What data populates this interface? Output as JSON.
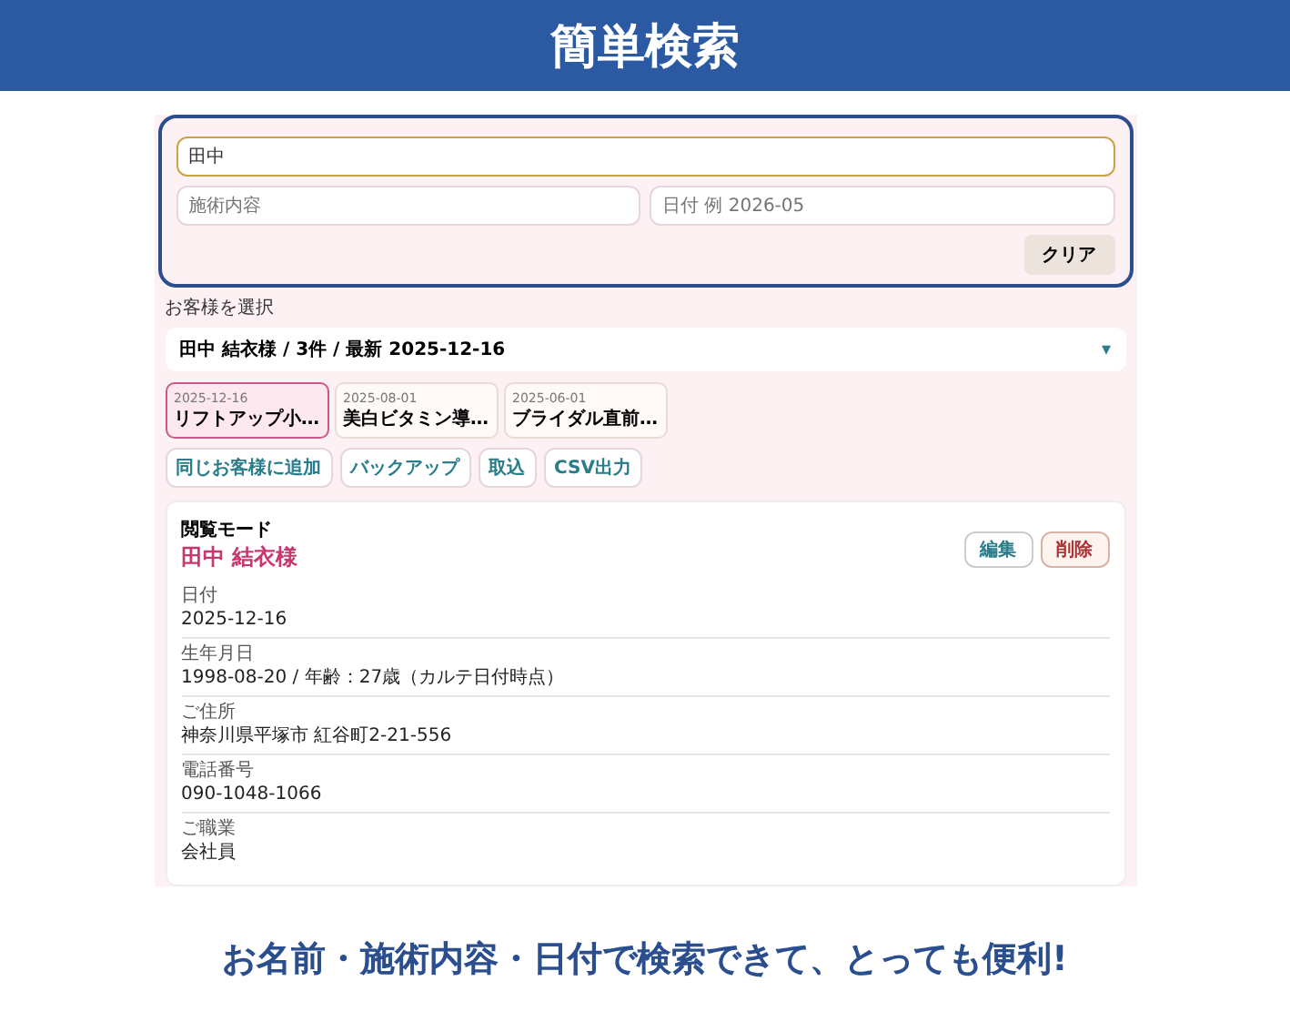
{
  "header": {
    "title": "簡単検索"
  },
  "search": {
    "name_value": "田中",
    "treatment_placeholder": "施術内容",
    "date_placeholder": "日付 例 2026-05",
    "clear_button": "クリア"
  },
  "customer_select": {
    "label": "お客様を選択",
    "value": "田中 結衣様 / 3件 / 最新 2025-12-16",
    "caret": "▾"
  },
  "visits": [
    {
      "date": "2025-12-16",
      "title": "リフトアップ小…",
      "selected": true
    },
    {
      "date": "2025-08-01",
      "title": "美白ビタミン導…",
      "selected": false
    },
    {
      "date": "2025-06-01",
      "title": "ブライダル直前…",
      "selected": false
    }
  ],
  "actions": [
    "同じお客様に追加",
    "バックアップ",
    "取込",
    "CSV出力"
  ],
  "record": {
    "mode": "閲覧モード",
    "name": "田中 結衣様",
    "edit_button": "編集",
    "delete_button": "削除",
    "fields": [
      {
        "label": "日付",
        "value": "2025-12-16"
      },
      {
        "label": "生年月日",
        "value": "1998-08-20 / 年齢：27歳（カルテ日付時点）"
      },
      {
        "label": "ご住所",
        "value": "神奈川県平塚市 紅谷町2-21-556"
      },
      {
        "label": "電話番号",
        "value": "090-1048-1066"
      },
      {
        "label": "ご職業",
        "value": "会社員"
      }
    ]
  },
  "caption": "お名前・施術内容・日付で検索できて、とっても便利!"
}
